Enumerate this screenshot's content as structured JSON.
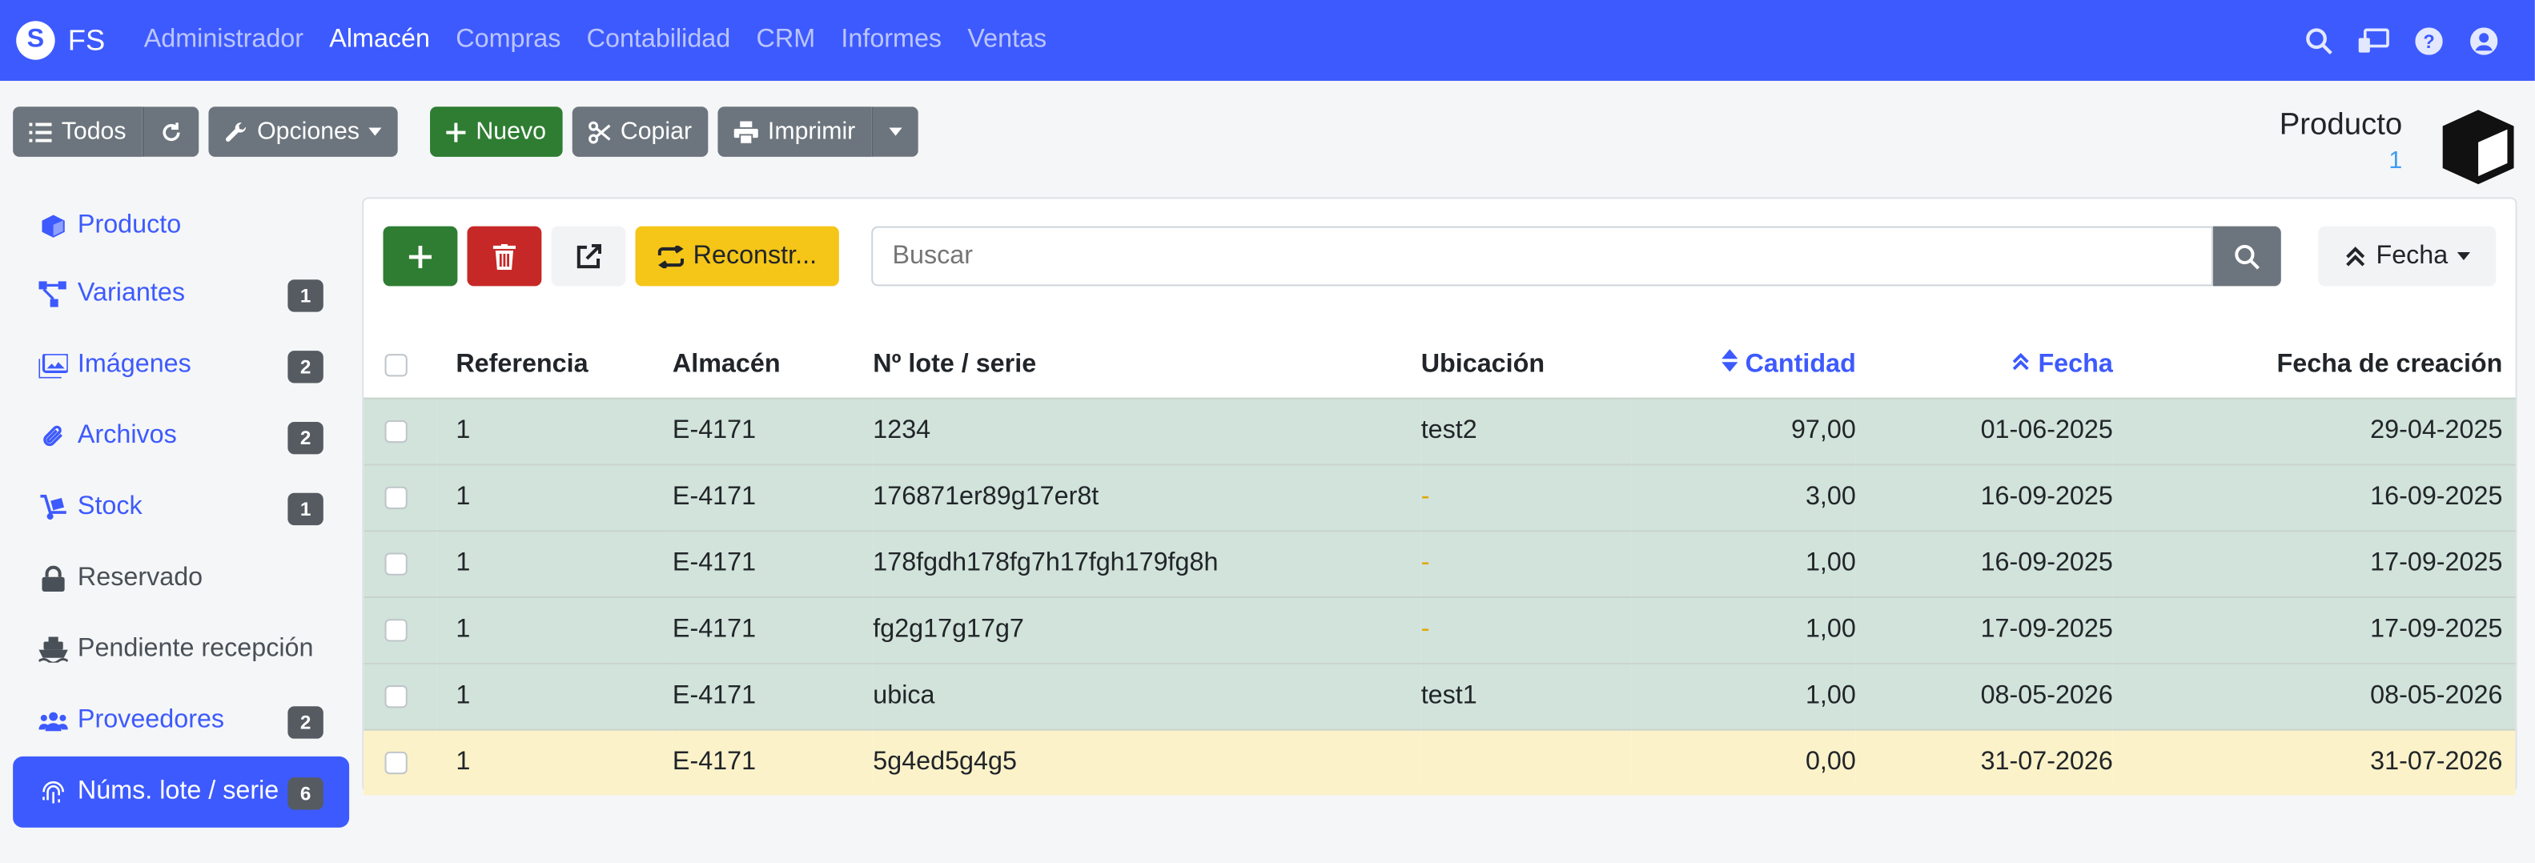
{
  "brand": {
    "logo_letter": "S",
    "name": "FS"
  },
  "nav": {
    "items": [
      "Administrador",
      "Almacén",
      "Compras",
      "Contabilidad",
      "CRM",
      "Informes",
      "Ventas"
    ],
    "active": "Almacén",
    "right_icons": [
      "search-icon",
      "desktop-icon",
      "help-icon",
      "user-icon"
    ]
  },
  "toolbar": {
    "todos_label": "Todos",
    "opciones_label": "Opciones",
    "nuevo_label": "Nuevo",
    "copiar_label": "Copiar",
    "imprimir_label": "Imprimir"
  },
  "product": {
    "title": "Producto",
    "count": "1"
  },
  "sidebar": {
    "items": [
      {
        "label": "Producto",
        "badge": "",
        "icon": "cube-icon",
        "link": true
      },
      {
        "label": "Variantes",
        "badge": "1",
        "icon": "variants-icon",
        "link": true
      },
      {
        "label": "Imágenes",
        "badge": "2",
        "icon": "images-icon",
        "link": true
      },
      {
        "label": "Archivos",
        "badge": "2",
        "icon": "paperclip-icon",
        "link": true
      },
      {
        "label": "Stock",
        "badge": "1",
        "icon": "dolly-icon",
        "link": true
      },
      {
        "label": "Reservado",
        "badge": "",
        "icon": "lock-icon",
        "link": false
      },
      {
        "label": "Pendiente recepción",
        "badge": "",
        "icon": "ship-icon",
        "link": false
      },
      {
        "label": "Proveedores",
        "badge": "2",
        "icon": "users-icon",
        "link": true
      },
      {
        "label": "Núms. lote / serie",
        "badge": "6",
        "icon": "fingerprint-icon",
        "link": true,
        "active": true
      }
    ]
  },
  "panel": {
    "rebuild_label": "Reconstr...",
    "search_placeholder": "Buscar",
    "sort_label": "Fecha"
  },
  "table": {
    "headers": [
      "Referencia",
      "Almacén",
      "Nº lote / serie",
      "Ubicación",
      "Cantidad",
      "Fecha",
      "Fecha de creación"
    ],
    "rows": [
      [
        "1",
        "E-4171",
        "1234",
        "test2",
        "97,00",
        "01-06-2025",
        "29-04-2025"
      ],
      [
        "1",
        "E-4171",
        "176871er89g17er8t",
        "-",
        "3,00",
        "16-09-2025",
        "16-09-2025"
      ],
      [
        "1",
        "E-4171",
        "178fgdh178fg7h17fgh179fg8h",
        "-",
        "1,00",
        "16-09-2025",
        "17-09-2025"
      ],
      [
        "1",
        "E-4171",
        "fg2g17g17g7",
        "-",
        "1,00",
        "17-09-2025",
        "17-09-2025"
      ],
      [
        "1",
        "E-4171",
        "ubica",
        "test1",
        "1,00",
        "08-05-2026",
        "08-05-2026"
      ],
      [
        "1",
        "E-4171",
        "5g4ed5g4g5",
        "",
        "0,00",
        "31-07-2026",
        "31-07-2026"
      ]
    ],
    "row_status": [
      "ok",
      "ok",
      "ok",
      "ok",
      "ok",
      "warning"
    ]
  },
  "colors": {
    "primary": "#3d5afe",
    "success_row": "#d1e3da",
    "warning_row": "#fbf2c9"
  }
}
